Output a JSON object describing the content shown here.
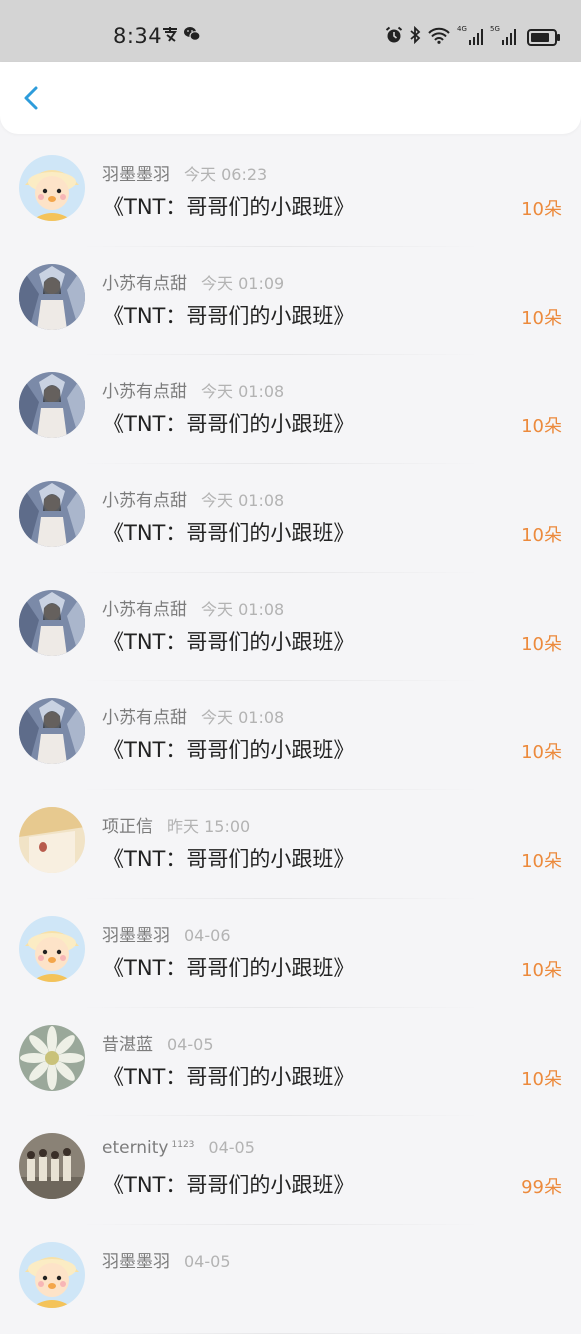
{
  "status_bar": {
    "time": "8:34",
    "left_icons": [
      "payment-app-icon",
      "wechat-icon"
    ],
    "right_icons": [
      "alarm-icon",
      "bluetooth-icon",
      "wifi-icon",
      "signal-4g-icon",
      "signal-5g-icon",
      "battery-icon"
    ],
    "signal_tags": [
      "4G",
      "5G"
    ]
  },
  "header": {
    "back_icon": "chevron-left-icon",
    "accent_color": "#2d9cdb"
  },
  "colors": {
    "amount": "#ec8a3c",
    "name": "#7c7c7c",
    "time": "#b3b3b3"
  },
  "gifts": [
    {
      "name": "羽墨墨羽",
      "badge": "",
      "time": "今天 06:23",
      "title": "《TNT：哥哥们的小跟班》",
      "amount": "10朵",
      "avatar": "cartoon"
    },
    {
      "name": "小苏有点甜",
      "badge": "",
      "time": "今天 01:09",
      "title": "《TNT：哥哥们的小跟班》",
      "amount": "10朵",
      "avatar": "girl"
    },
    {
      "name": "小苏有点甜",
      "badge": "",
      "time": "今天 01:08",
      "title": "《TNT：哥哥们的小跟班》",
      "amount": "10朵",
      "avatar": "girl"
    },
    {
      "name": "小苏有点甜",
      "badge": "",
      "time": "今天 01:08",
      "title": "《TNT：哥哥们的小跟班》",
      "amount": "10朵",
      "avatar": "girl"
    },
    {
      "name": "小苏有点甜",
      "badge": "",
      "time": "今天 01:08",
      "title": "《TNT：哥哥们的小跟班》",
      "amount": "10朵",
      "avatar": "girl"
    },
    {
      "name": "小苏有点甜",
      "badge": "",
      "time": "今天 01:08",
      "title": "《TNT：哥哥们的小跟班》",
      "amount": "10朵",
      "avatar": "girl"
    },
    {
      "name": "项正信",
      "badge": "",
      "time": "昨天 15:00",
      "title": "《TNT：哥哥们的小跟班》",
      "amount": "10朵",
      "avatar": "beige"
    },
    {
      "name": "羽墨墨羽",
      "badge": "",
      "time": "04-06",
      "title": "《TNT：哥哥们的小跟班》",
      "amount": "10朵",
      "avatar": "cartoon"
    },
    {
      "name": "昔湛蓝",
      "badge": "",
      "time": "04-05",
      "title": "《TNT：哥哥们的小跟班》",
      "amount": "10朵",
      "avatar": "flower"
    },
    {
      "name": "eternity",
      "badge": "1123",
      "time": "04-05",
      "title": "《TNT：哥哥们的小跟班》",
      "amount": "99朵",
      "avatar": "group"
    },
    {
      "name": "羽墨墨羽",
      "badge": "",
      "time": "04-05",
      "title": "",
      "amount": "",
      "avatar": "cartoon"
    }
  ]
}
